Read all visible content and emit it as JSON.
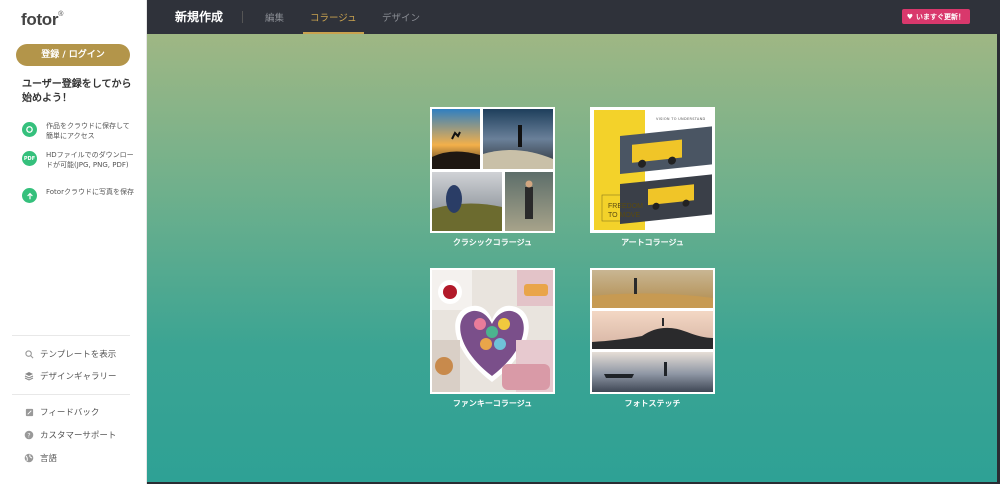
{
  "sidebar": {
    "logo": "fotor",
    "signup_label": "登録 / ログイン",
    "promo_text": "ユーザー登録をしてから始めよう！",
    "features": [
      {
        "icon": "cloud-sync-icon",
        "icon_text": "",
        "text": "作品をクラウドに保存して簡単にアクセス"
      },
      {
        "icon": "pdf-icon",
        "icon_text": "PDF",
        "text": "HDファイルでのダウンロードが可能(JPG, PNG, PDF)"
      },
      {
        "icon": "upload-arrow-icon",
        "icon_text": "",
        "text": "Fotorクラウドに写真を保存"
      }
    ],
    "menu": [
      {
        "icon": "search-icon",
        "label": "テンプレートを表示"
      },
      {
        "icon": "layers-icon",
        "label": "デザインギャラリー"
      },
      {
        "icon": "edit-icon",
        "label": "フィードバック"
      },
      {
        "icon": "help-icon",
        "label": "カスタマーサポート"
      },
      {
        "icon": "globe-icon",
        "label": "言語"
      }
    ]
  },
  "topbar": {
    "title": "新規作成",
    "tabs": [
      {
        "label": "編集",
        "active": false
      },
      {
        "label": "コラージュ",
        "active": true
      },
      {
        "label": "デザイン",
        "active": false
      }
    ],
    "upgrade_label": "いますぐ更新！"
  },
  "collages": [
    {
      "label": "クラシックコラージュ"
    },
    {
      "label": "アートコラージュ",
      "art_title": "FREEDOM TO MOVE",
      "art_small": "VISION TO UNDERSTAND"
    },
    {
      "label": "ファンキーコラージュ"
    },
    {
      "label": "フォトステッチ"
    }
  ],
  "colors": {
    "accent": "#b3954a",
    "tab_active": "#c9a24f",
    "upgrade": "#d9386c",
    "feature_icon": "#35c07c",
    "topbar": "#2f323a"
  }
}
